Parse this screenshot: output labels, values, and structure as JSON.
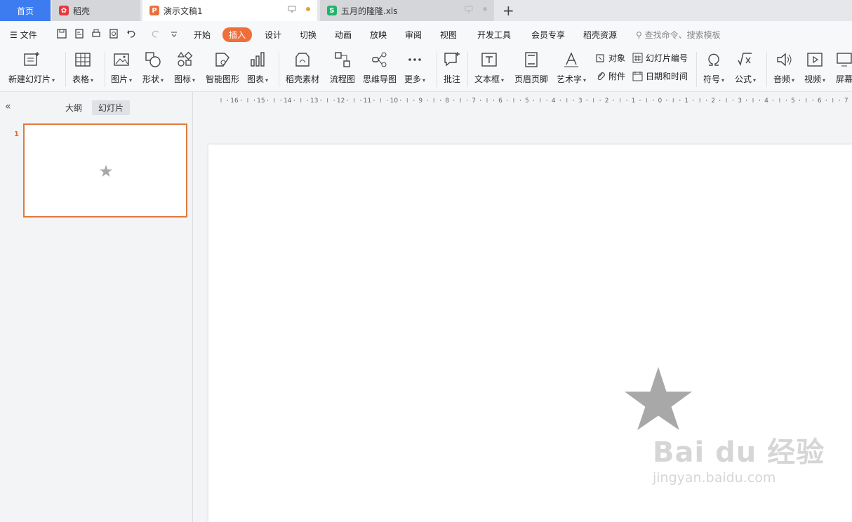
{
  "tabs": {
    "home": "首页",
    "daoke": "稻壳",
    "doc": "演示文稿1",
    "xls": "五月的隆隆.xls"
  },
  "menu": {
    "file": "文件",
    "items": [
      "开始",
      "插入",
      "设计",
      "切换",
      "动画",
      "放映",
      "审阅",
      "视图",
      "开发工具",
      "会员专享",
      "稻壳资源"
    ],
    "active": "插入",
    "search_placeholder": "查找命令、搜索模板"
  },
  "ribbon": {
    "new_slide": "新建幻灯片",
    "table": "表格",
    "picture": "图片",
    "shape": "形状",
    "icon": "图标",
    "smart_art": "智能图形",
    "chart": "图表",
    "daoke_material": "稻壳素材",
    "flowchart": "流程图",
    "mindmap": "思维导图",
    "more": "更多",
    "comment": "批注",
    "textbox": "文本框",
    "header_footer": "页眉页脚",
    "wordart": "艺术字",
    "object": "对象",
    "attachment": "附件",
    "slide_number": "幻灯片编号",
    "datetime": "日期和时间",
    "symbol": "符号",
    "formula": "公式",
    "audio": "音频",
    "video": "视频",
    "screen": "屏幕"
  },
  "panel": {
    "outline_tab": "大纲",
    "slides_tab": "幻灯片",
    "slide_number": "1"
  },
  "ruler": {
    "labels": [
      "16",
      "15",
      "14",
      "13",
      "12",
      "11",
      "10",
      "9",
      "8",
      "7",
      "6",
      "5",
      "4",
      "3",
      "2",
      "1",
      "0",
      "1",
      "2",
      "3",
      "4",
      "5",
      "6",
      "7"
    ]
  },
  "watermark": {
    "line1": "Bai du 经验",
    "line2": "jingyan.baidu.com"
  },
  "colors": {
    "accent": "#ef6f3a",
    "home_tab": "#3d7cf0",
    "star": "#a8a8a8"
  }
}
